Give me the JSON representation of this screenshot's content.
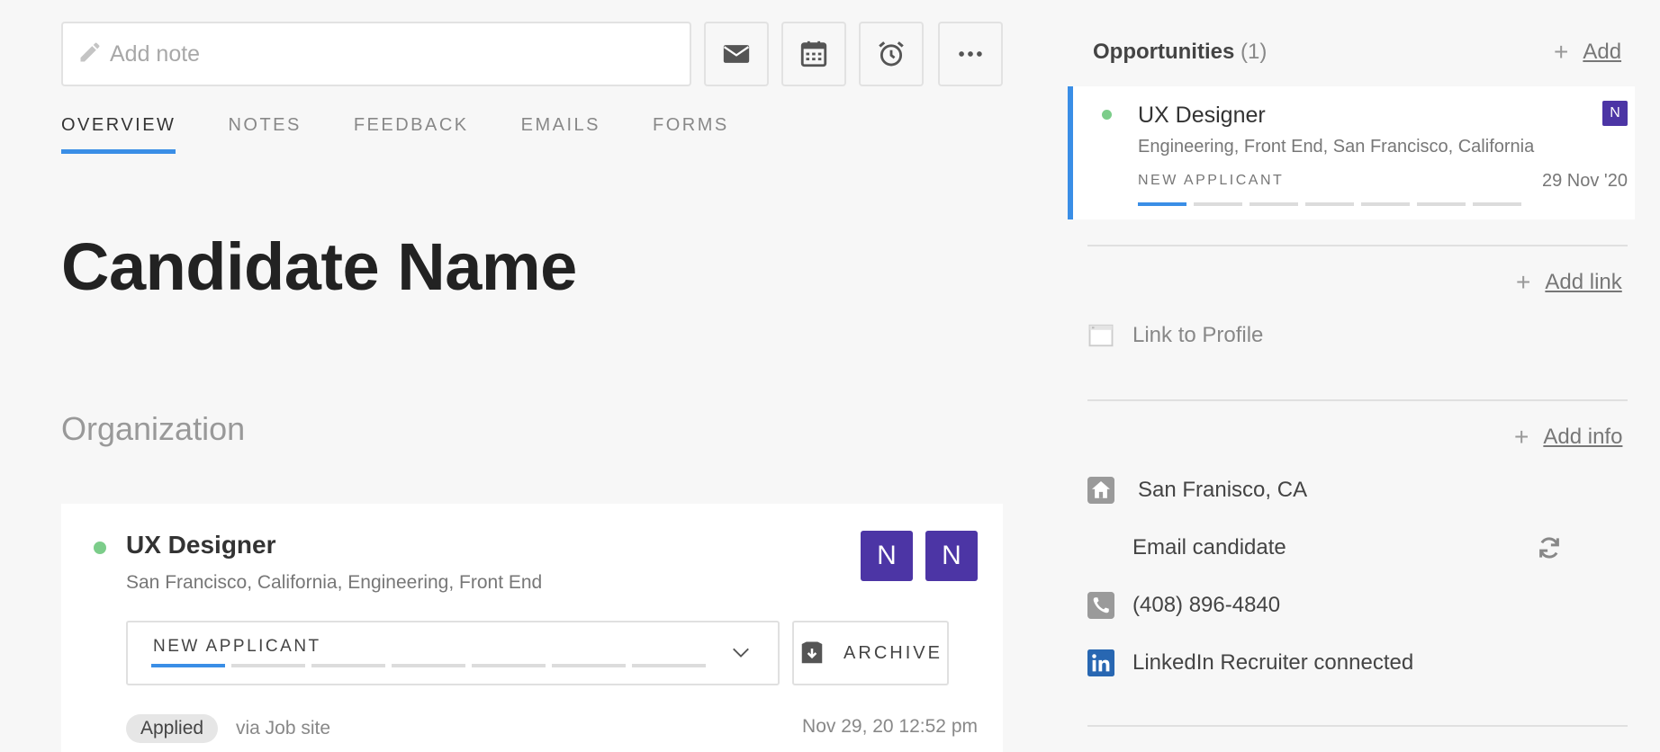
{
  "note": {
    "placeholder": "Add note"
  },
  "tabs": [
    {
      "label": "OVERVIEW",
      "active": true
    },
    {
      "label": "NOTES"
    },
    {
      "label": "FEEDBACK"
    },
    {
      "label": "EMAILS"
    },
    {
      "label": "FORMS"
    }
  ],
  "candidate": {
    "name": "Candidate Name"
  },
  "organization": {
    "label": "Organization"
  },
  "opportunity": {
    "title": "UX Designer",
    "subtitle": "San Francisco, California, Engineering, Front End",
    "badges": [
      "N",
      "N"
    ],
    "stage": "NEW APPLICANT",
    "stage_progress": "1 of 7",
    "archive_label": "ARCHIVE",
    "applied": "Applied",
    "via": "via Job site",
    "applied_date": "Nov 29, 20 12:52 pm"
  },
  "sidebar": {
    "opps_title": "Opportunities",
    "opps_count": "(1)",
    "add_label": "Add",
    "opp": {
      "title": "UX Designer",
      "subtitle": "Engineering, Front End, San Francisco, California",
      "stage": "NEW APPLICANT",
      "stage_progress": "1 of 7",
      "date": "29 Nov '20",
      "badge": "N"
    },
    "add_link_label": "Add link",
    "link_to_profile": "Link to Profile",
    "add_info_label": "Add info",
    "location": "San Franisco, CA",
    "email": "Email candidate",
    "phone": "(408) 896-4840",
    "linkedin": "LinkedIn Recruiter connected"
  },
  "colors": {
    "accent": "#3a8ee6",
    "badge": "#4c35a5",
    "active_dot": "#7ccd8a"
  }
}
